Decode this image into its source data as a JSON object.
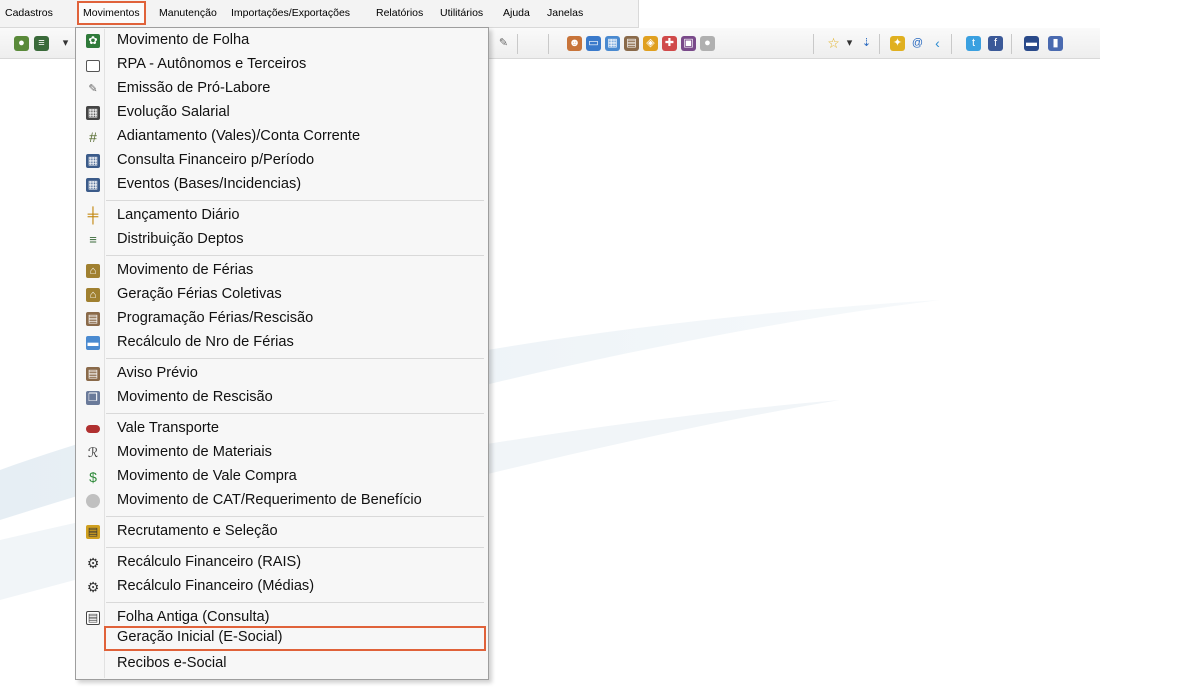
{
  "menubar": {
    "items": [
      {
        "label": "Cadastros"
      },
      {
        "label": "Movimentos"
      },
      {
        "label": "Manutenção"
      },
      {
        "label": "Importações/Exportações"
      },
      {
        "label": "Relatórios"
      },
      {
        "label": "Utilitários"
      },
      {
        "label": "Ajuda"
      },
      {
        "label": "Janelas"
      }
    ],
    "active_item": "Movimentos",
    "highlight_color": "#e0623a"
  },
  "menu": {
    "items": [
      {
        "label": "Movimento de Folha",
        "icon": "folha-icon"
      },
      {
        "label": "RPA - Autônomos e Terceiros",
        "icon": "rpa-icon"
      },
      {
        "label": "Emissão de Pró-Labore",
        "icon": "pro-labore-icon"
      },
      {
        "label": "Evolução Salarial",
        "icon": "evolucao-icon"
      },
      {
        "label": "Adiantamento (Vales)/Conta Corrente",
        "icon": "adiantamento-icon"
      },
      {
        "label": "Consulta Financeiro p/Período",
        "icon": "table-icon"
      },
      {
        "label": "Eventos (Bases/Incidencias)",
        "icon": "table-icon"
      },
      {
        "label": "Lançamento Diário",
        "icon": "lancamento-icon"
      },
      {
        "label": "Distribuição Deptos",
        "icon": "distribuicao-icon"
      },
      {
        "label": "Movimento de Férias",
        "icon": "ferias-icon"
      },
      {
        "label": "Geração Férias Coletivas",
        "icon": "ferias-icon"
      },
      {
        "label": "Programação Férias/Rescisão",
        "icon": "programacao-icon"
      },
      {
        "label": "Recálculo de Nro de Férias",
        "icon": "recalculo-icon"
      },
      {
        "label": "Aviso Prévio",
        "icon": "aviso-icon"
      },
      {
        "label": "Movimento de Rescisão",
        "icon": "rescisao-icon"
      },
      {
        "label": "Vale Transporte",
        "icon": "bus-icon"
      },
      {
        "label": "Movimento de Materiais",
        "icon": "materiais-icon"
      },
      {
        "label": "Movimento de Vale Compra",
        "icon": "vale-compra-icon"
      },
      {
        "label": "Movimento de CAT/Requerimento de Benefício",
        "icon": "cat-icon"
      },
      {
        "label": "Recrutamento e Seleção",
        "icon": "recrutamento-icon"
      },
      {
        "label": "Recálculo Financeiro (RAIS)",
        "icon": "gear-icon"
      },
      {
        "label": "Recálculo Financeiro (Médias)",
        "icon": "gear-icon"
      },
      {
        "label": "Folha Antiga (Consulta)",
        "icon": "folha-antiga-icon"
      },
      {
        "label": "Geração Inicial (E-Social)",
        "icon": ""
      },
      {
        "label": "Recibos e-Social",
        "icon": ""
      }
    ],
    "highlighted_item": "Geração Inicial (E-Social)"
  }
}
